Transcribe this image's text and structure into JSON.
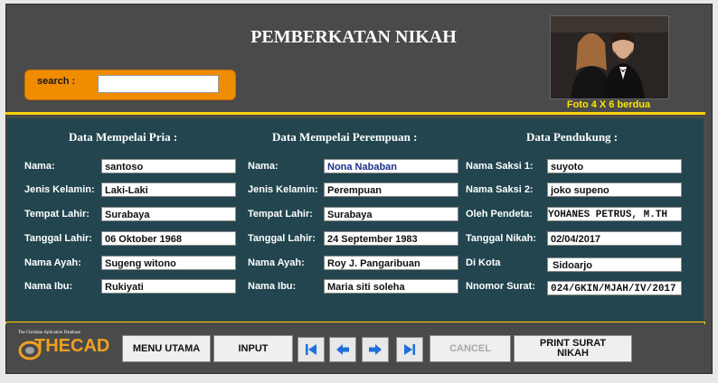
{
  "header": {
    "title": "PEMBERKATAN NIKAH",
    "search_label": "search :",
    "search_value": "",
    "photo_caption": "Foto 4 X 6 berdua"
  },
  "sections": {
    "groom": "Data Mempelai  Pria :",
    "bride": "Data Mempelai Perempuan :",
    "support": "Data Pendukung :"
  },
  "groom": {
    "nama_label": "Nama:",
    "nama": "santoso",
    "jk_label": "Jenis Kelamin:",
    "jk": "Laki-Laki",
    "tempat_label": "Tempat Lahir:",
    "tempat": "Surabaya",
    "tanggal_label": "Tanggal Lahir:",
    "tanggal": "06 Oktober  1968",
    "ayah_label": "Nama Ayah:",
    "ayah": "Sugeng witono",
    "ibu_label": "Nama Ibu:",
    "ibu": "Rukiyati"
  },
  "bride": {
    "nama_label": "Nama:",
    "nama": "Nona Nababan",
    "jk_label": "Jenis Kelamin:",
    "jk": "Perempuan",
    "tempat_label": "Tempat Lahir:",
    "tempat": "Surabaya",
    "tanggal_label": "Tanggal Lahir:",
    "tanggal": "24 September  1983",
    "ayah_label": "Nama Ayah:",
    "ayah": "Roy J. Pangaribuan",
    "ibu_label": "Nama Ibu:",
    "ibu": "Maria siti soleha"
  },
  "support": {
    "saksi1_label": "Nama Saksi 1:",
    "saksi1": "suyoto",
    "saksi2_label": "Nama Saksi 2:",
    "saksi2": "joko supeno",
    "pendeta_label": "Oleh Pendeta:",
    "pendeta": "YOHANES PETRUS, M.TH",
    "tgl_nikah_label": "Tanggal Nikah:",
    "tgl_nikah": "02/04/2017",
    "kota_label": "Di Kota",
    "kota": "Sidoarjo",
    "surat_label": "Nnomor Surat:",
    "surat": "024/GKIN/MJAH/IV/2017"
  },
  "logo": {
    "tagline": "The Christian Aplication Database",
    "name": "THECAD"
  },
  "toolbar": {
    "menu_utama": "MENU UTAMA",
    "input": "INPUT",
    "cancel": "CANCEL",
    "print_line1": "PRINT SURAT",
    "print_line2": "NIKAH"
  },
  "colors": {
    "accent_yellow": "#f5d000",
    "search_orange": "#f08c00",
    "panel_teal": "#22454f",
    "nav_arrow_blue": "#1e6fd9"
  },
  "icons": [
    "first-record-icon",
    "prev-record-icon",
    "next-record-icon",
    "last-record-icon"
  ]
}
